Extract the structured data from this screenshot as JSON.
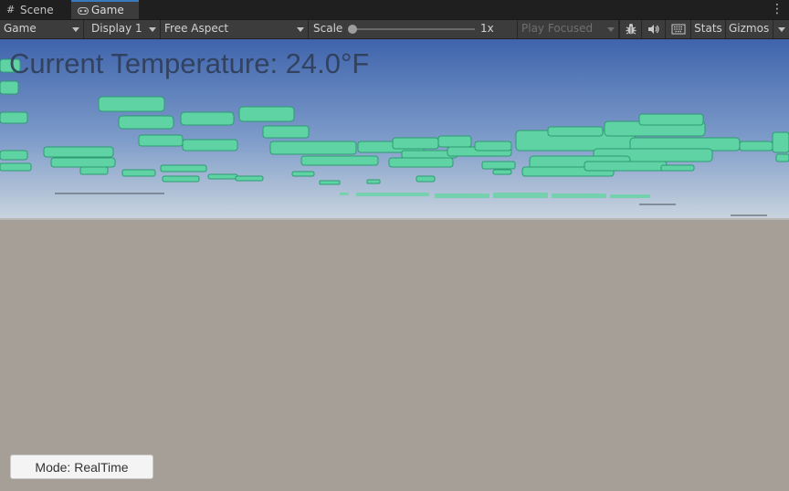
{
  "tabs": [
    {
      "label": "Scene",
      "icon": "grid-icon"
    },
    {
      "label": "Game",
      "icon": "gamepad-icon"
    }
  ],
  "toolbar": {
    "display_mode": "Game",
    "display": "Display 1",
    "aspect": "Free Aspect",
    "scale_label": "Scale",
    "scale_value": "1x",
    "play_mode": "Play Focused",
    "stats_label": "Stats",
    "gizmos_label": "Gizmos"
  },
  "game": {
    "temperature_text": "Current Temperature: 24.0°F",
    "mode_button": "Mode: RealTime"
  },
  "colors": {
    "sky_top": "#3f64ac",
    "sky_horizon": "#c9d4de",
    "ground": "#a69f98",
    "block": "#5fd3a3",
    "tab_accent": "#3a79bb"
  }
}
